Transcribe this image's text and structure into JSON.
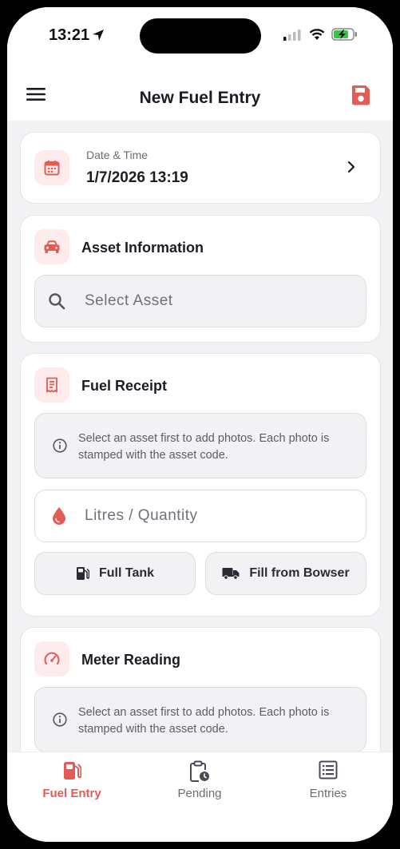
{
  "status_bar": {
    "time": "13:21"
  },
  "header": {
    "title": "New Fuel Entry"
  },
  "date_card": {
    "label": "Date & Time",
    "value": "1/7/2026 13:19"
  },
  "asset_card": {
    "title": "Asset Information",
    "search_placeholder": "Select Asset"
  },
  "receipt_card": {
    "title": "Fuel Receipt",
    "info": "Select an asset first to add photos. Each photo is stamped with the asset code.",
    "quantity_placeholder": "Litres / Quantity",
    "full_tank_label": "Full Tank",
    "bowser_label": "Fill from Bowser"
  },
  "meter_card": {
    "title": "Meter Reading",
    "info": "Select an asset first to add photos. Each photo is stamped with the asset code."
  },
  "tabs": [
    {
      "label": "Fuel Entry",
      "icon": "fuel-pump-icon",
      "active": true
    },
    {
      "label": "Pending",
      "icon": "clipboard-clock-icon",
      "active": false
    },
    {
      "label": "Entries",
      "icon": "list-icon",
      "active": false
    }
  ],
  "colors": {
    "accent": "#e25c55",
    "badge_bg": "#fdeceb",
    "background": "#f2f2f4"
  }
}
